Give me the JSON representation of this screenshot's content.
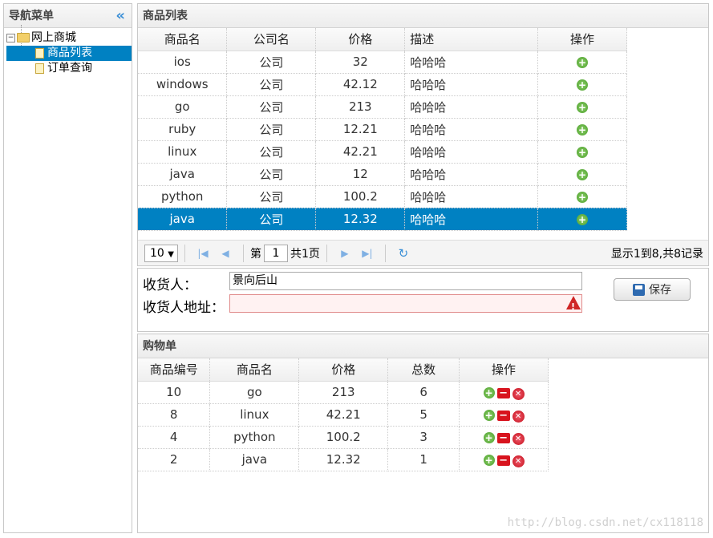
{
  "nav": {
    "title": "导航菜单",
    "collapse_glyph": "«",
    "root": {
      "label": "网上商城"
    },
    "items": [
      {
        "label": "商品列表",
        "selected": true
      },
      {
        "label": "订单查询",
        "selected": false
      }
    ]
  },
  "products": {
    "title": "商品列表",
    "columns": [
      "商品名",
      "公司名",
      "价格",
      "描述",
      "操作"
    ],
    "rows": [
      {
        "name": "ios",
        "company": "公司",
        "price": "32",
        "desc": "哈哈哈"
      },
      {
        "name": "windows",
        "company": "公司",
        "price": "42.12",
        "desc": "哈哈哈"
      },
      {
        "name": "go",
        "company": "公司",
        "price": "213",
        "desc": "哈哈哈"
      },
      {
        "name": "ruby",
        "company": "公司",
        "price": "12.21",
        "desc": "哈哈哈"
      },
      {
        "name": "linux",
        "company": "公司",
        "price": "42.21",
        "desc": "哈哈哈"
      },
      {
        "name": "java",
        "company": "公司",
        "price": "12",
        "desc": "哈哈哈"
      },
      {
        "name": "python",
        "company": "公司",
        "price": "100.2",
        "desc": "哈哈哈"
      },
      {
        "name": "java",
        "company": "公司",
        "price": "12.32",
        "desc": "哈哈哈",
        "selected": true
      }
    ],
    "pager": {
      "page_size": "10",
      "page_prefix": "第",
      "page_value": "1",
      "page_suffix": "共1页",
      "info": "显示1到8,共8记录"
    }
  },
  "form": {
    "receiver_label": "收货人：",
    "receiver_value": "景向后山",
    "address_label": "收货人地址：",
    "address_value": "",
    "save_label": "保存"
  },
  "cart": {
    "title": "购物单",
    "columns": [
      "商品编号",
      "商品名",
      "价格",
      "总数",
      "操作"
    ],
    "rows": [
      {
        "id": "10",
        "name": "go",
        "price": "213",
        "count": "6"
      },
      {
        "id": "8",
        "name": "linux",
        "price": "42.21",
        "count": "5"
      },
      {
        "id": "4",
        "name": "python",
        "price": "100.2",
        "count": "3"
      },
      {
        "id": "2",
        "name": "java",
        "price": "12.32",
        "count": "1"
      }
    ]
  },
  "watermark": "http://blog.csdn.net/cx118118",
  "colors": {
    "selection": "#0081c2",
    "add": "#4b9f2c",
    "remove": "#d8141e",
    "warning": "#cf2525"
  }
}
